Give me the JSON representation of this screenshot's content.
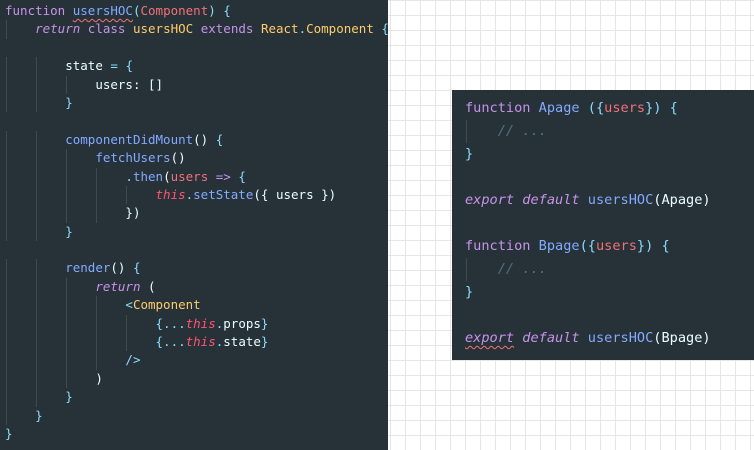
{
  "hoc_code": {
    "lines": [
      [
        {
          "t": "function",
          "c": "kw"
        },
        {
          "t": " "
        },
        {
          "t": "usersHOC",
          "c": "fn squig"
        },
        {
          "t": "(",
          "c": "punc"
        },
        {
          "t": "Component",
          "c": "param"
        },
        {
          "t": ")",
          "c": "punc"
        },
        {
          "t": " "
        },
        {
          "t": "{",
          "c": "punc"
        }
      ],
      [
        {
          "t": "    "
        },
        {
          "t": "return",
          "c": "kw it"
        },
        {
          "t": " "
        },
        {
          "t": "class",
          "c": "kw"
        },
        {
          "t": " "
        },
        {
          "t": "usersHOC",
          "c": "cls"
        },
        {
          "t": " "
        },
        {
          "t": "extends",
          "c": "kw"
        },
        {
          "t": " "
        },
        {
          "t": "React",
          "c": "cls"
        },
        {
          "t": ".",
          "c": "punc"
        },
        {
          "t": "Component",
          "c": "cls"
        },
        {
          "t": " "
        },
        {
          "t": "{",
          "c": "punc"
        }
      ],
      [],
      [
        {
          "t": "        "
        },
        {
          "t": "state",
          "c": "plain"
        },
        {
          "t": " "
        },
        {
          "t": "=",
          "c": "punc"
        },
        {
          "t": " "
        },
        {
          "t": "{",
          "c": "punc"
        }
      ],
      [
        {
          "t": "            "
        },
        {
          "t": "users:",
          "c": "plain"
        },
        {
          "t": " "
        },
        {
          "t": "[]",
          "c": "plain"
        }
      ],
      [
        {
          "t": "        "
        },
        {
          "t": "}",
          "c": "punc"
        }
      ],
      [],
      [
        {
          "t": "        "
        },
        {
          "t": "componentDidMount",
          "c": "fn"
        },
        {
          "t": "()",
          "c": "plain"
        },
        {
          "t": " "
        },
        {
          "t": "{",
          "c": "punc"
        }
      ],
      [
        {
          "t": "            "
        },
        {
          "t": "fetchUsers",
          "c": "fn"
        },
        {
          "t": "()",
          "c": "plain"
        }
      ],
      [
        {
          "t": "                "
        },
        {
          "t": ".",
          "c": "punc"
        },
        {
          "t": "then",
          "c": "fn"
        },
        {
          "t": "(",
          "c": "plain"
        },
        {
          "t": "users",
          "c": "param"
        },
        {
          "t": " "
        },
        {
          "t": "=>",
          "c": "kw"
        },
        {
          "t": " "
        },
        {
          "t": "{",
          "c": "punc"
        }
      ],
      [
        {
          "t": "                    "
        },
        {
          "t": "this",
          "c": "this"
        },
        {
          "t": ".",
          "c": "punc"
        },
        {
          "t": "setState",
          "c": "fn"
        },
        {
          "t": "({",
          "c": "plain"
        },
        {
          "t": " "
        },
        {
          "t": "users",
          "c": "plain"
        },
        {
          "t": " "
        },
        {
          "t": "})",
          "c": "plain"
        }
      ],
      [
        {
          "t": "                "
        },
        {
          "t": "})",
          "c": "plain"
        }
      ],
      [
        {
          "t": "        "
        },
        {
          "t": "}",
          "c": "punc"
        }
      ],
      [],
      [
        {
          "t": "        "
        },
        {
          "t": "render",
          "c": "fn"
        },
        {
          "t": "()",
          "c": "plain"
        },
        {
          "t": " "
        },
        {
          "t": "{",
          "c": "punc"
        }
      ],
      [
        {
          "t": "            "
        },
        {
          "t": "return",
          "c": "kw it"
        },
        {
          "t": " "
        },
        {
          "t": "(",
          "c": "plain"
        }
      ],
      [
        {
          "t": "                "
        },
        {
          "t": "<",
          "c": "punc"
        },
        {
          "t": "Component",
          "c": "cls"
        }
      ],
      [
        {
          "t": "                    "
        },
        {
          "t": "{",
          "c": "punc"
        },
        {
          "t": "...",
          "c": "punc"
        },
        {
          "t": "this",
          "c": "this"
        },
        {
          "t": ".",
          "c": "punc"
        },
        {
          "t": "props",
          "c": "plain"
        },
        {
          "t": "}",
          "c": "punc"
        }
      ],
      [
        {
          "t": "                    "
        },
        {
          "t": "{",
          "c": "punc"
        },
        {
          "t": "...",
          "c": "punc"
        },
        {
          "t": "this",
          "c": "this"
        },
        {
          "t": ".",
          "c": "punc"
        },
        {
          "t": "state",
          "c": "plain"
        },
        {
          "t": "}",
          "c": "punc"
        }
      ],
      [
        {
          "t": "                "
        },
        {
          "t": "/>",
          "c": "punc"
        }
      ],
      [
        {
          "t": "            "
        },
        {
          "t": ")",
          "c": "plain"
        }
      ],
      [
        {
          "t": "        "
        },
        {
          "t": "}",
          "c": "punc"
        }
      ],
      [
        {
          "t": "    "
        },
        {
          "t": "}",
          "c": "punc"
        }
      ],
      [
        {
          "t": "}",
          "c": "punc"
        }
      ]
    ]
  },
  "usage_code": {
    "lines": [
      [
        {
          "t": "function",
          "c": "kw"
        },
        {
          "t": " "
        },
        {
          "t": "Apage",
          "c": "fn"
        },
        {
          "t": " "
        },
        {
          "t": "({",
          "c": "punc"
        },
        {
          "t": "users",
          "c": "param"
        },
        {
          "t": "})",
          "c": "punc"
        },
        {
          "t": " "
        },
        {
          "t": "{",
          "c": "punc"
        }
      ],
      [
        {
          "t": "    "
        },
        {
          "t": "// ...",
          "c": "comment"
        }
      ],
      [
        {
          "t": "}",
          "c": "punc"
        }
      ],
      [],
      [
        {
          "t": "export",
          "c": "kw it"
        },
        {
          "t": " "
        },
        {
          "t": "default",
          "c": "kw it"
        },
        {
          "t": " "
        },
        {
          "t": "usersHOC",
          "c": "fn"
        },
        {
          "t": "(",
          "c": "plain"
        },
        {
          "t": "Apage",
          "c": "plain"
        },
        {
          "t": ")",
          "c": "plain"
        }
      ],
      [],
      [
        {
          "t": "function",
          "c": "kw"
        },
        {
          "t": " "
        },
        {
          "t": "Bpage",
          "c": "fn"
        },
        {
          "t": "({",
          "c": "punc"
        },
        {
          "t": "users",
          "c": "param"
        },
        {
          "t": "})",
          "c": "punc"
        },
        {
          "t": " "
        },
        {
          "t": "{",
          "c": "punc"
        }
      ],
      [
        {
          "t": "    "
        },
        {
          "t": "// ...",
          "c": "comment"
        }
      ],
      [
        {
          "t": "}",
          "c": "punc"
        }
      ],
      [],
      [
        {
          "t": "export",
          "c": "kw it squig"
        },
        {
          "t": " "
        },
        {
          "t": "default",
          "c": "kw it"
        },
        {
          "t": " "
        },
        {
          "t": "usersHOC",
          "c": "fn"
        },
        {
          "t": "(",
          "c": "plain"
        },
        {
          "t": "Bpage",
          "c": "plain"
        },
        {
          "t": ")",
          "c": "plain"
        }
      ]
    ]
  },
  "colors": {
    "editor_background": "#263238",
    "keyword": "#c792ea",
    "function": "#82aaff",
    "class": "#ffcb6b",
    "parameter": "#f07178",
    "this": "#ff5370",
    "punctuation": "#89ddff",
    "text": "#eeffff",
    "comment": "#546e7a"
  }
}
